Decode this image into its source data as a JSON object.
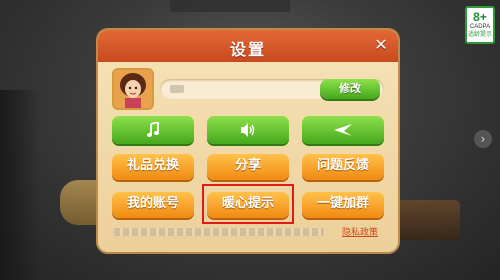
{
  "age_badge": {
    "age": "8+",
    "org": "CADPA",
    "tip": "适龄提示"
  },
  "dialog": {
    "title": "设置",
    "close_symbol": "✕",
    "edit_label": "修改",
    "icon_buttons": [
      {
        "icon": "music-note-icon"
      },
      {
        "icon": "speaker-icon"
      },
      {
        "icon": "vibrate-icon"
      }
    ],
    "action_buttons": {
      "gift_exchange": "礼品兑换",
      "share": "分享",
      "feedback": "问题反馈",
      "my_account": "我的账号",
      "warm_tips": "暖心提示",
      "join_group": "一键加群"
    },
    "privacy_link": "隐私政策"
  },
  "colors": {
    "header": "#d65a28",
    "panel": "#f2dcaa",
    "green_button": "#5bbf2a",
    "orange_button": "#f7a22a",
    "highlight": "#e21a1a"
  }
}
